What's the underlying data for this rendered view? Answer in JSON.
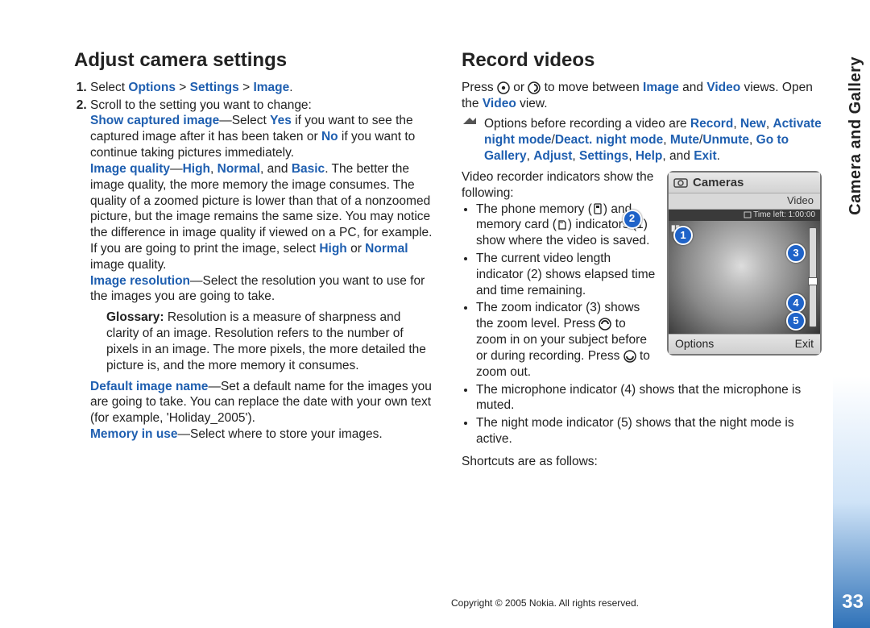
{
  "side_label": "Camera and Gallery",
  "page_number": "33",
  "copyright": "Copyright © 2005 Nokia. All rights reserved.",
  "left": {
    "heading": "Adjust camera settings",
    "step1_a": "Select ",
    "step1_b_options": "Options",
    "step1_gt1": " > ",
    "step1_c_settings": "Settings",
    "step1_gt2": " > ",
    "step1_d_image": "Image",
    "step1_e": ".",
    "step2_intro": "Scroll to the setting you want to change:",
    "show_captured_label": "Show captured image",
    "show_captured_text1": "—Select ",
    "yes": "Yes",
    "show_captured_text2": " if you want to see the captured image after it has been taken or ",
    "no": "No",
    "show_captured_text3": " if you want to continue taking pictures immediately.",
    "image_quality_label": "Image quality",
    "image_quality_dash": "—",
    "iq_high": "High",
    "iq_sep1": ", ",
    "iq_normal": "Normal",
    "iq_sep2": ", and ",
    "iq_basic": "Basic",
    "iq_text": ". The better the image quality, the more memory the image consumes. The quality of a zoomed picture is lower than that of a nonzoomed picture, but the image remains the same size. You may notice the difference in image quality if viewed on a PC, for example. If you are going to print the image, select ",
    "iq_high2": "High",
    "iq_or": " or ",
    "iq_normal2": "Normal",
    "iq_end": " image quality.",
    "image_res_label": "Image resolution",
    "image_res_text": "—Select the resolution you want to use for the images you are going to take.",
    "glossary_label": "Glossary:",
    "glossary_text": " Resolution is a measure of sharpness and clarity of an image. Resolution refers to the number of pixels in an image. The more pixels, the more detailed the picture is, and the more memory it consumes.",
    "default_name_label": "Default image name",
    "default_name_text": "—Set a default name for the images you are going to take. You can replace the date with your own text (for example, 'Holiday_2005').",
    "memory_label": "Memory in use",
    "memory_text": "—Select where to store your images."
  },
  "right": {
    "heading": "Record videos",
    "press_a": "Press ",
    "press_b": " or ",
    "press_c": " to move between ",
    "image_word": "Image",
    "and_word": " and ",
    "video_word": "Video",
    "press_end": " views. Open the ",
    "video_word2": "Video",
    "press_end2": " view.",
    "tip_a": "Options before recording a video are ",
    "opt_record": "Record",
    "sep": ", ",
    "opt_new": "New",
    "opt_activate": "Activate night mode",
    "slash": "/",
    "opt_deact": "Deact. night mode",
    "opt_mute": "Mute",
    "opt_unmute": "Unmute",
    "opt_gallery": "Go to Gallery",
    "opt_adjust": "Adjust",
    "opt_settings": "Settings",
    "opt_help": "Help",
    "tip_and": ", and ",
    "opt_exit": "Exit",
    "tip_end": ".",
    "indicators_intro": "Video recorder indicators show the following:",
    "bullet1_a": "The phone memory (",
    "bullet1_b": ") and memory card (",
    "bullet1_c": ") indicators (1) show where the video is saved.",
    "bullet2": "The current video length indicator (2) shows elapsed time and time remaining.",
    "bullet3_a": "The zoom indicator (3) shows the zoom level. Press ",
    "bullet3_b": " to zoom in on your subject before or during recording. Press ",
    "bullet3_c": " to zoom out.",
    "bullet4": "The microphone indicator (4) shows that the microphone is muted.",
    "bullet5": "The night mode indicator (5) shows that the night mode is active.",
    "shortcuts": "Shortcuts are as follows:"
  },
  "phone": {
    "title": "Cameras",
    "tab": "Video",
    "time": "Time left: 1:00:00",
    "options": "Options",
    "exit": "Exit"
  }
}
